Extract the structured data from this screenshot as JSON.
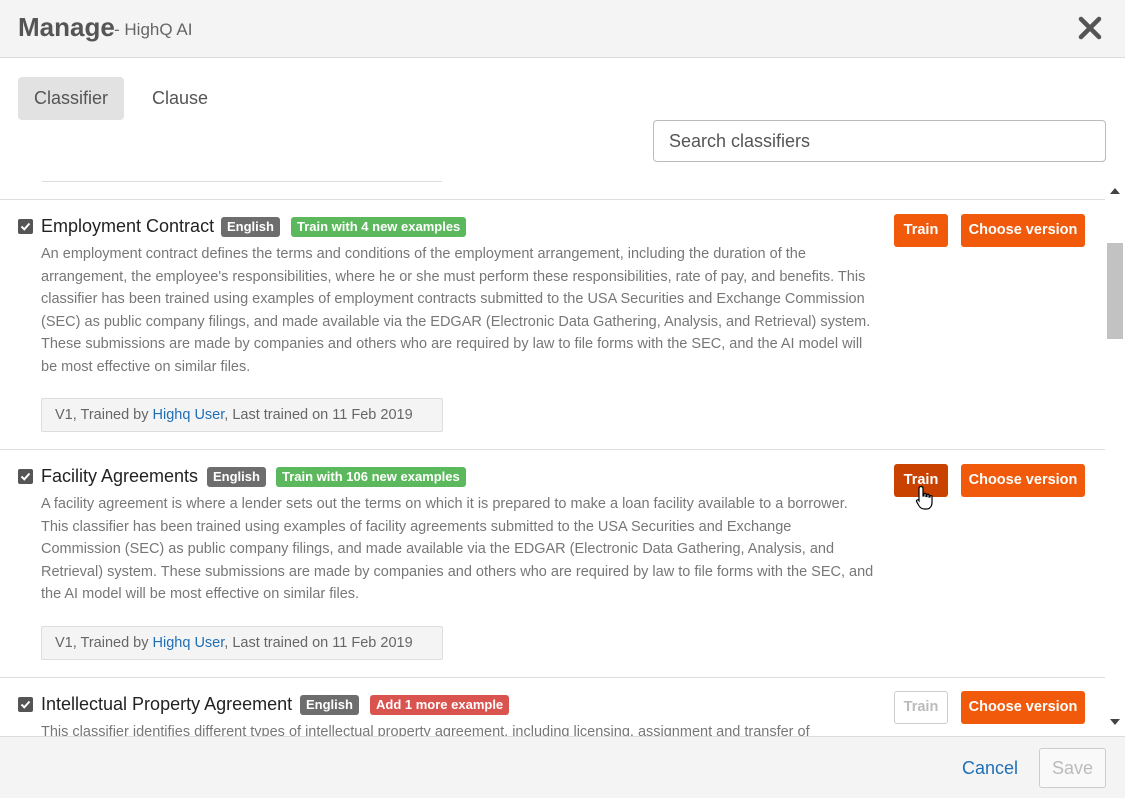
{
  "header": {
    "title": "Manage",
    "subtitle": "- HighQ AI",
    "close_icon": "close-icon"
  },
  "tabs": [
    {
      "label": "Classifier",
      "active": true
    },
    {
      "label": "Clause",
      "active": false
    }
  ],
  "search": {
    "placeholder": "Search classifiers",
    "value": ""
  },
  "classifiers": [
    {
      "name": "Employment Contract",
      "checked": true,
      "language": "English",
      "status_badge": "Train with 4 new examples",
      "status_color": "#5cb85c",
      "desc_lines": [
        "An employment contract defines the terms and conditions of the employment arrangement, including the duration of the",
        "arrangement, the employee's responsibilities, where he or she must perform these responsibilities, rate of pay, and benefits. This",
        "classifier has been trained using examples of employment contracts submitted to the USA Securities and Exchange Commission",
        "(SEC) as public company filings, and made available via the EDGAR (Electronic Data Gathering, Analysis, and Retrieval) system.",
        "These submissions are made by companies and others who are required by law to file forms with the SEC, and the AI model will",
        "be most effective on similar files."
      ],
      "meta_prefix": "V1, Trained by ",
      "meta_user": "Highq User",
      "meta_suffix": ", Last trained on 11 Feb 2019",
      "train_label": "Train",
      "train_enabled": true,
      "choose_label": "Choose version"
    },
    {
      "name": "Facility Agreements",
      "checked": true,
      "language": "English",
      "status_badge": "Train with 106 new examples",
      "status_color": "#5cb85c",
      "desc_lines": [
        "A facility agreement is where a lender sets out the terms on which it is prepared to make a loan facility available to a borrower.",
        "This classifier has been trained using examples of facility agreements submitted to the USA Securities and Exchange",
        "Commission (SEC) as public company filings, and made available via the EDGAR (Electronic Data Gathering, Analysis, and",
        "Retrieval) system. These submissions are made by companies and others who are required by law to file forms with the SEC, and",
        "the AI model will be most effective on similar files."
      ],
      "meta_prefix": "V1, Trained by ",
      "meta_user": "Highq User",
      "meta_suffix": ", Last trained on 11 Feb 2019",
      "train_label": "Train",
      "train_enabled": true,
      "choose_label": "Choose version"
    },
    {
      "name": "Intellectual Property Agreement",
      "checked": true,
      "language": "English",
      "status_badge": "Add 1 more example",
      "status_color": "#d9534f",
      "desc_lines": [
        "This classifier identifies different types of intellectual property agreement, including licensing, assignment and transfer of"
      ],
      "train_label": "Train",
      "train_enabled": false,
      "choose_label": "Choose version"
    }
  ],
  "footer": {
    "cancel_label": "Cancel",
    "save_label": "Save"
  }
}
